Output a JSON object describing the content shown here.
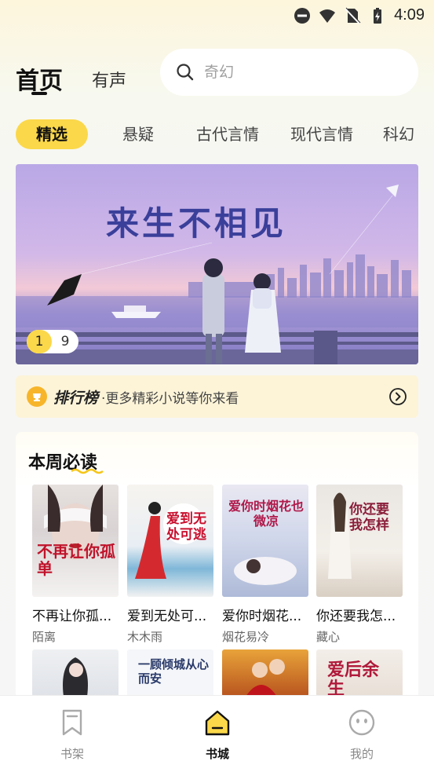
{
  "status_bar": {
    "time": "4:09"
  },
  "header": {
    "tabs": [
      {
        "label": "首页"
      },
      {
        "label": "有声"
      }
    ],
    "search": {
      "placeholder": "奇幻"
    }
  },
  "categories": [
    {
      "label": "精选",
      "active": true
    },
    {
      "label": "悬疑"
    },
    {
      "label": "古代言情"
    },
    {
      "label": "现代言情"
    },
    {
      "label": "科幻"
    }
  ],
  "banner": {
    "title": "来生不相见",
    "page_current": "1",
    "page_total": "9"
  },
  "rank_bar": {
    "title": "排行榜",
    "subtitle": "·更多精彩小说等你来看"
  },
  "weekly": {
    "title": "本周必读",
    "books": [
      {
        "title": "不再让你孤...",
        "author": "陌离",
        "cover_text": "不再让你孤单"
      },
      {
        "title": "爱到无处可...",
        "author": "木木雨",
        "cover_text": "爱到无处可逃"
      },
      {
        "title": "爱你时烟花...",
        "author": "烟花易冷",
        "cover_text": "爱你时烟花也微凉"
      },
      {
        "title": "你还要我怎...",
        "author": "藏心",
        "cover_text": "你还要我怎样"
      }
    ],
    "row2_covers": [
      {
        "cover_text": ""
      },
      {
        "cover_text": "一顾倾城从心而安"
      },
      {
        "cover_text": ""
      },
      {
        "cover_text": "爱后余生"
      }
    ]
  },
  "bottom_nav": [
    {
      "label": "书架",
      "icon": "bookmark-icon"
    },
    {
      "label": "书城",
      "icon": "store-icon",
      "active": true
    },
    {
      "label": "我的",
      "icon": "face-icon"
    }
  ],
  "colors": {
    "accent": "#fbd84a",
    "banner_title": "#3a3f9a"
  }
}
